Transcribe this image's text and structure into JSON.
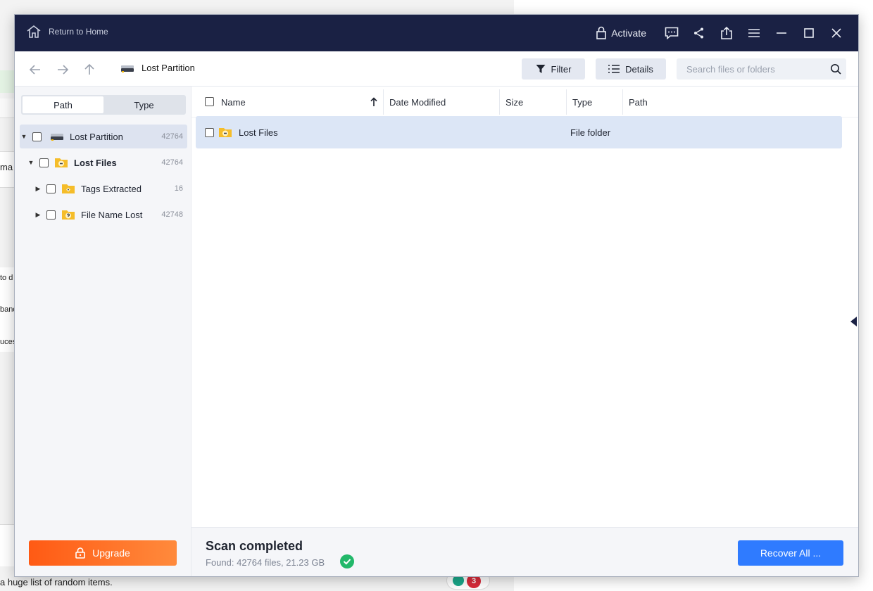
{
  "background": {
    "fragments": [
      "ma",
      "to d",
      "band",
      "uces"
    ],
    "bottom_text": "a huge list of random items.",
    "badge_count": "3"
  },
  "titlebar": {
    "home_label": "Return to Home",
    "activate_label": "Activate"
  },
  "toolbar": {
    "breadcrumb": "Lost Partition",
    "filter_label": "Filter",
    "details_label": "Details",
    "search_placeholder": "Search files or folders"
  },
  "sidebar": {
    "tabs": [
      "Path",
      "Type"
    ],
    "active_tab": "Path",
    "tree": [
      {
        "label": "Lost Partition",
        "count": "42764",
        "level": 0,
        "expanded": true,
        "selected": true,
        "icon": "drive-icon"
      },
      {
        "label": "Lost Files",
        "count": "42764",
        "level": 1,
        "expanded": true,
        "selected": false,
        "icon": "lost-folder-icon"
      },
      {
        "label": "Tags Extracted",
        "count": "16",
        "level": 2,
        "expanded": false,
        "selected": false,
        "icon": "tag-folder-icon"
      },
      {
        "label": "File Name Lost",
        "count": "42748",
        "level": 2,
        "expanded": false,
        "selected": false,
        "icon": "question-folder-icon"
      }
    ],
    "upgrade_label": "Upgrade"
  },
  "list": {
    "columns": [
      "Name",
      "Date Modified",
      "Size",
      "Type",
      "Path"
    ],
    "sort_column": "Name",
    "sort_direction": "ascending",
    "rows": [
      {
        "name": "Lost Files",
        "date_modified": "",
        "size": "",
        "type": "File folder",
        "path": ""
      }
    ]
  },
  "status": {
    "title": "Scan completed",
    "found": "Found: 42764 files, 21.23 GB",
    "recover_label": "Recover All ..."
  },
  "colors": {
    "titlebar": "#1a2144",
    "accent": "#2f7bff",
    "upgrade": "#ff6a22",
    "success": "#22b86a",
    "selection": "#dce6f6"
  }
}
